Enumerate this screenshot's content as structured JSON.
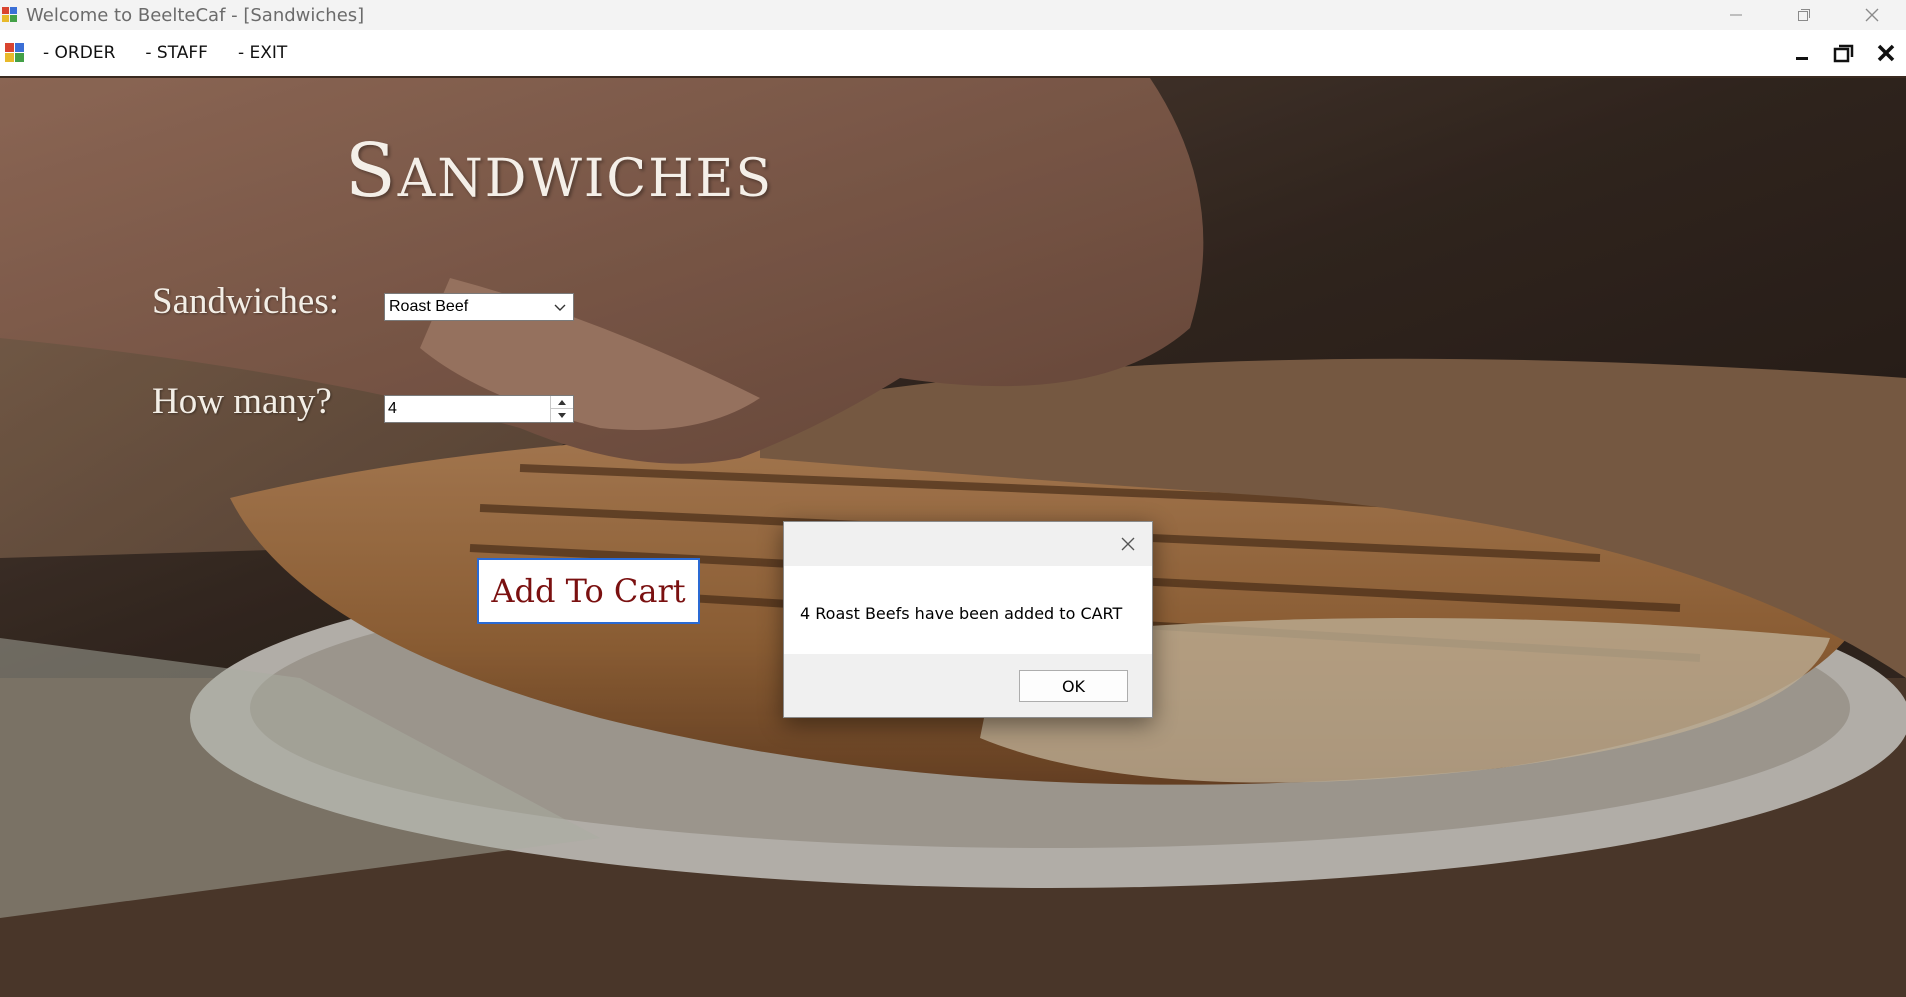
{
  "window": {
    "title": "Welcome to BeelteCaf - [Sandwiches]",
    "controls": [
      "minimize-icon",
      "restore-icon",
      "close-icon"
    ]
  },
  "menubar": {
    "items": [
      "- ORDER",
      "- STAFF",
      "- EXIT"
    ],
    "mdi_controls": [
      "minimize-icon",
      "restore-icon",
      "close-icon"
    ]
  },
  "form": {
    "heading": "Sandwiches",
    "sandwich_label": "Sandwiches:",
    "sandwich_selected": "Roast Beef",
    "quantity_label": "How many?",
    "quantity_value": "4",
    "add_button": "Add To Cart"
  },
  "dialog": {
    "message": "4 Roast Beefs have been added to CART",
    "ok_label": "OK"
  },
  "colors": {
    "button_text": "#7a1010",
    "focus_border": "#2a6ad4",
    "heading": "#f4efe8"
  }
}
